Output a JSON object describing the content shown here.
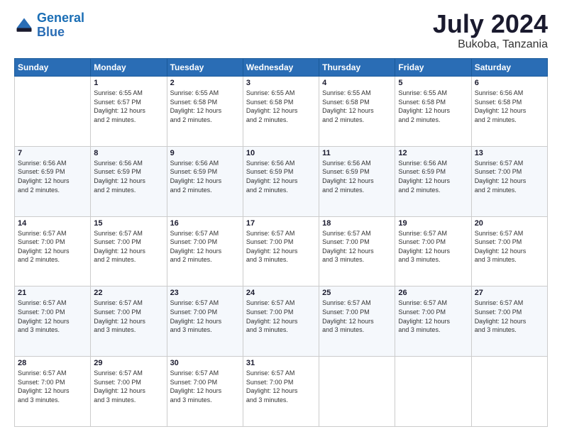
{
  "logo": {
    "line1": "General",
    "line2": "Blue"
  },
  "title": "July 2024",
  "subtitle": "Bukoba, Tanzania",
  "days_of_week": [
    "Sunday",
    "Monday",
    "Tuesday",
    "Wednesday",
    "Thursday",
    "Friday",
    "Saturday"
  ],
  "weeks": [
    [
      {
        "day": "",
        "info": ""
      },
      {
        "day": "1",
        "info": "Sunrise: 6:55 AM\nSunset: 6:57 PM\nDaylight: 12 hours\nand 2 minutes."
      },
      {
        "day": "2",
        "info": "Sunrise: 6:55 AM\nSunset: 6:58 PM\nDaylight: 12 hours\nand 2 minutes."
      },
      {
        "day": "3",
        "info": "Sunrise: 6:55 AM\nSunset: 6:58 PM\nDaylight: 12 hours\nand 2 minutes."
      },
      {
        "day": "4",
        "info": "Sunrise: 6:55 AM\nSunset: 6:58 PM\nDaylight: 12 hours\nand 2 minutes."
      },
      {
        "day": "5",
        "info": "Sunrise: 6:55 AM\nSunset: 6:58 PM\nDaylight: 12 hours\nand 2 minutes."
      },
      {
        "day": "6",
        "info": "Sunrise: 6:56 AM\nSunset: 6:58 PM\nDaylight: 12 hours\nand 2 minutes."
      }
    ],
    [
      {
        "day": "7",
        "info": "Sunrise: 6:56 AM\nSunset: 6:59 PM\nDaylight: 12 hours\nand 2 minutes."
      },
      {
        "day": "8",
        "info": "Sunrise: 6:56 AM\nSunset: 6:59 PM\nDaylight: 12 hours\nand 2 minutes."
      },
      {
        "day": "9",
        "info": "Sunrise: 6:56 AM\nSunset: 6:59 PM\nDaylight: 12 hours\nand 2 minutes."
      },
      {
        "day": "10",
        "info": "Sunrise: 6:56 AM\nSunset: 6:59 PM\nDaylight: 12 hours\nand 2 minutes."
      },
      {
        "day": "11",
        "info": "Sunrise: 6:56 AM\nSunset: 6:59 PM\nDaylight: 12 hours\nand 2 minutes."
      },
      {
        "day": "12",
        "info": "Sunrise: 6:56 AM\nSunset: 6:59 PM\nDaylight: 12 hours\nand 2 minutes."
      },
      {
        "day": "13",
        "info": "Sunrise: 6:57 AM\nSunset: 7:00 PM\nDaylight: 12 hours\nand 2 minutes."
      }
    ],
    [
      {
        "day": "14",
        "info": "Sunrise: 6:57 AM\nSunset: 7:00 PM\nDaylight: 12 hours\nand 2 minutes."
      },
      {
        "day": "15",
        "info": "Sunrise: 6:57 AM\nSunset: 7:00 PM\nDaylight: 12 hours\nand 2 minutes."
      },
      {
        "day": "16",
        "info": "Sunrise: 6:57 AM\nSunset: 7:00 PM\nDaylight: 12 hours\nand 2 minutes."
      },
      {
        "day": "17",
        "info": "Sunrise: 6:57 AM\nSunset: 7:00 PM\nDaylight: 12 hours\nand 3 minutes."
      },
      {
        "day": "18",
        "info": "Sunrise: 6:57 AM\nSunset: 7:00 PM\nDaylight: 12 hours\nand 3 minutes."
      },
      {
        "day": "19",
        "info": "Sunrise: 6:57 AM\nSunset: 7:00 PM\nDaylight: 12 hours\nand 3 minutes."
      },
      {
        "day": "20",
        "info": "Sunrise: 6:57 AM\nSunset: 7:00 PM\nDaylight: 12 hours\nand 3 minutes."
      }
    ],
    [
      {
        "day": "21",
        "info": "Sunrise: 6:57 AM\nSunset: 7:00 PM\nDaylight: 12 hours\nand 3 minutes."
      },
      {
        "day": "22",
        "info": "Sunrise: 6:57 AM\nSunset: 7:00 PM\nDaylight: 12 hours\nand 3 minutes."
      },
      {
        "day": "23",
        "info": "Sunrise: 6:57 AM\nSunset: 7:00 PM\nDaylight: 12 hours\nand 3 minutes."
      },
      {
        "day": "24",
        "info": "Sunrise: 6:57 AM\nSunset: 7:00 PM\nDaylight: 12 hours\nand 3 minutes."
      },
      {
        "day": "25",
        "info": "Sunrise: 6:57 AM\nSunset: 7:00 PM\nDaylight: 12 hours\nand 3 minutes."
      },
      {
        "day": "26",
        "info": "Sunrise: 6:57 AM\nSunset: 7:00 PM\nDaylight: 12 hours\nand 3 minutes."
      },
      {
        "day": "27",
        "info": "Sunrise: 6:57 AM\nSunset: 7:00 PM\nDaylight: 12 hours\nand 3 minutes."
      }
    ],
    [
      {
        "day": "28",
        "info": "Sunrise: 6:57 AM\nSunset: 7:00 PM\nDaylight: 12 hours\nand 3 minutes."
      },
      {
        "day": "29",
        "info": "Sunrise: 6:57 AM\nSunset: 7:00 PM\nDaylight: 12 hours\nand 3 minutes."
      },
      {
        "day": "30",
        "info": "Sunrise: 6:57 AM\nSunset: 7:00 PM\nDaylight: 12 hours\nand 3 minutes."
      },
      {
        "day": "31",
        "info": "Sunrise: 6:57 AM\nSunset: 7:00 PM\nDaylight: 12 hours\nand 3 minutes."
      },
      {
        "day": "",
        "info": ""
      },
      {
        "day": "",
        "info": ""
      },
      {
        "day": "",
        "info": ""
      }
    ]
  ]
}
